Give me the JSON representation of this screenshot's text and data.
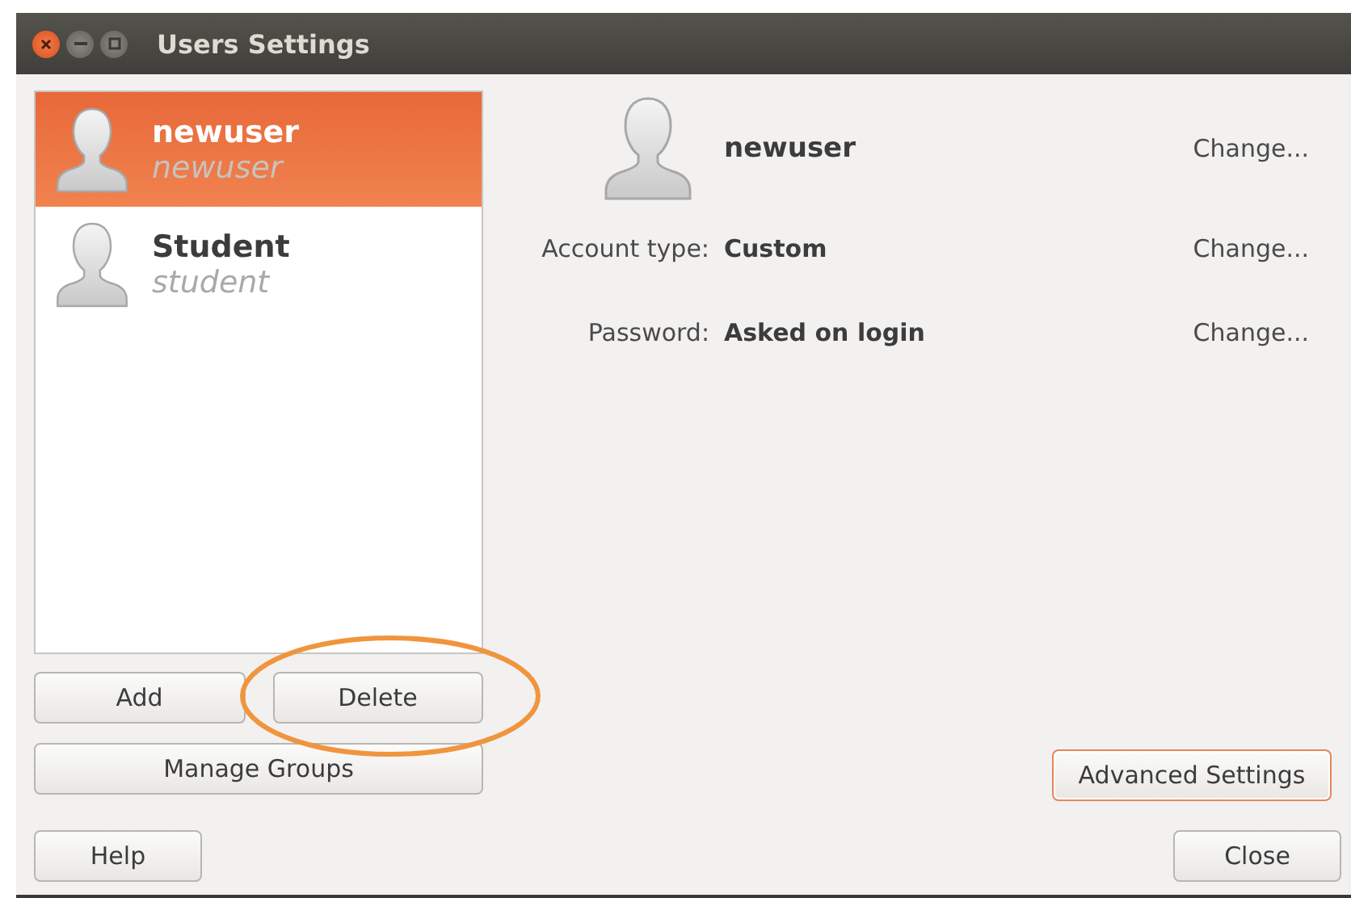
{
  "window": {
    "title": "Users Settings"
  },
  "users": [
    {
      "name": "newuser",
      "login": "newuser",
      "selected": true
    },
    {
      "name": "Student",
      "login": "student",
      "selected": false
    }
  ],
  "details": {
    "name": "newuser",
    "name_action": "Change...",
    "fields": [
      {
        "label": "Account type:",
        "value": "Custom",
        "action": "Change..."
      },
      {
        "label": "Password:",
        "value": "Asked on login",
        "action": "Change..."
      }
    ]
  },
  "list_buttons": [
    {
      "label": "Add",
      "highlighted": false
    },
    {
      "label": "Delete",
      "highlighted": true
    }
  ],
  "manage_button": {
    "label": "Manage Groups"
  },
  "advanced_button": {
    "label": "Advanced Settings",
    "focused": true
  },
  "help_button": {
    "label": "Help"
  },
  "close_button": {
    "label": "Close"
  }
}
